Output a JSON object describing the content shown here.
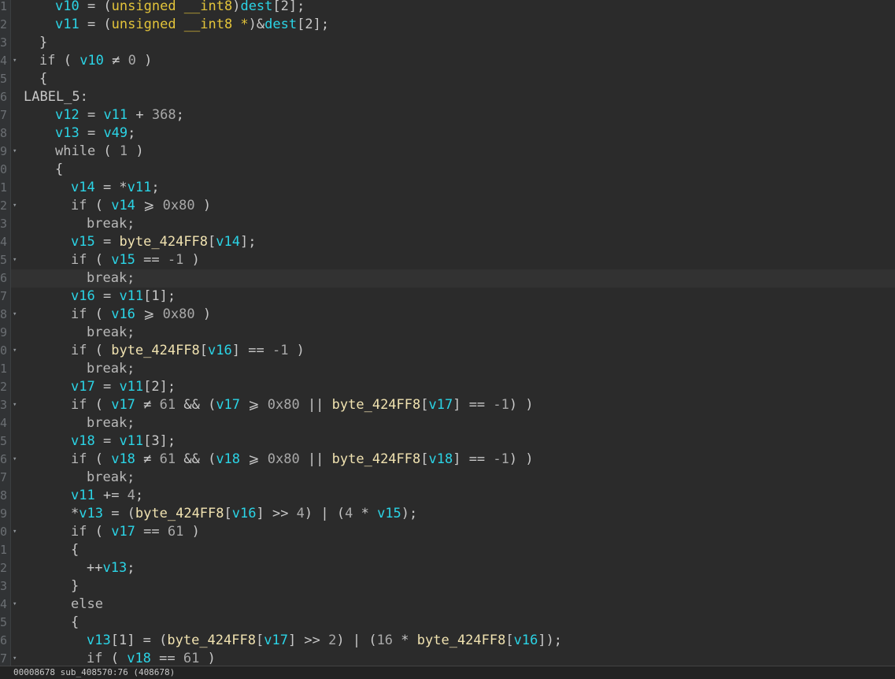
{
  "status_bar": {
    "text": "00008678 sub_408570:76 (408678)"
  },
  "gutter_numbers": [
    "1",
    "2",
    "3",
    "4",
    "5",
    "6",
    "7",
    "8",
    "9",
    "0",
    "1",
    "2",
    "3",
    "4",
    "5",
    "6",
    "7",
    "8",
    "9",
    "0",
    "1",
    "2",
    "3",
    "4",
    "5",
    "6",
    "7",
    "8",
    "9",
    "0",
    "1",
    "2",
    "3",
    "4",
    "5",
    "6",
    "7"
  ],
  "highlighted_line_index": 15,
  "code_lines": [
    {
      "indent": 2,
      "fold": false,
      "tokens": [
        [
          "v10",
          "var"
        ],
        [
          " = (",
          "op"
        ],
        [
          "unsigned __int8",
          "type"
        ],
        [
          ")",
          "op"
        ],
        [
          "dest",
          "var"
        ],
        [
          "[2];",
          "op"
        ]
      ]
    },
    {
      "indent": 2,
      "fold": false,
      "tokens": [
        [
          "v11",
          "var"
        ],
        [
          " = (",
          "op"
        ],
        [
          "unsigned __int8 *",
          "type"
        ],
        [
          ")&",
          "op"
        ],
        [
          "dest",
          "var"
        ],
        [
          "[2];",
          "op"
        ]
      ]
    },
    {
      "indent": 1,
      "fold": false,
      "tokens": [
        [
          "}",
          "op"
        ]
      ]
    },
    {
      "indent": 1,
      "fold": true,
      "tokens": [
        [
          "if",
          "kw"
        ],
        [
          " ( ",
          "op"
        ],
        [
          "v10",
          "var"
        ],
        [
          " ≠ ",
          "op"
        ],
        [
          "0",
          "num"
        ],
        [
          " )",
          "op"
        ]
      ]
    },
    {
      "indent": 1,
      "fold": false,
      "tokens": [
        [
          "{",
          "op"
        ]
      ]
    },
    {
      "indent": 0,
      "fold": false,
      "tokens": [
        [
          "LABEL_5:",
          "txt"
        ]
      ]
    },
    {
      "indent": 2,
      "fold": false,
      "tokens": [
        [
          "v12",
          "var"
        ],
        [
          " = ",
          "op"
        ],
        [
          "v11",
          "var"
        ],
        [
          " + ",
          "op"
        ],
        [
          "368",
          "num"
        ],
        [
          ";",
          "op"
        ]
      ]
    },
    {
      "indent": 2,
      "fold": false,
      "tokens": [
        [
          "v13",
          "var"
        ],
        [
          " = ",
          "op"
        ],
        [
          "v49",
          "var"
        ],
        [
          ";",
          "op"
        ]
      ]
    },
    {
      "indent": 2,
      "fold": true,
      "tokens": [
        [
          "while",
          "kw"
        ],
        [
          " ( ",
          "op"
        ],
        [
          "1",
          "num"
        ],
        [
          " )",
          "op"
        ]
      ]
    },
    {
      "indent": 2,
      "fold": false,
      "tokens": [
        [
          "{",
          "op"
        ]
      ]
    },
    {
      "indent": 3,
      "fold": false,
      "tokens": [
        [
          "v14",
          "var"
        ],
        [
          " = *",
          "op"
        ],
        [
          "v11",
          "var"
        ],
        [
          ";",
          "op"
        ]
      ]
    },
    {
      "indent": 3,
      "fold": true,
      "tokens": [
        [
          "if",
          "kw"
        ],
        [
          " ( ",
          "op"
        ],
        [
          "v14",
          "var"
        ],
        [
          " ⩾ ",
          "op"
        ],
        [
          "0x80",
          "num"
        ],
        [
          " )",
          "op"
        ]
      ]
    },
    {
      "indent": 4,
      "fold": false,
      "tokens": [
        [
          "break;",
          "kw"
        ]
      ]
    },
    {
      "indent": 3,
      "fold": false,
      "tokens": [
        [
          "v15",
          "var"
        ],
        [
          " = ",
          "op"
        ],
        [
          "byte_424FF8",
          "fn"
        ],
        [
          "[",
          "op"
        ],
        [
          "v14",
          "var"
        ],
        [
          "];",
          "op"
        ]
      ]
    },
    {
      "indent": 3,
      "fold": true,
      "tokens": [
        [
          "if",
          "kw"
        ],
        [
          " ( ",
          "op"
        ],
        [
          "v15",
          "var"
        ],
        [
          " == ",
          "op"
        ],
        [
          "-1",
          "num"
        ],
        [
          " )",
          "op"
        ]
      ]
    },
    {
      "indent": 4,
      "fold": false,
      "tokens": [
        [
          "break;",
          "kw"
        ]
      ]
    },
    {
      "indent": 3,
      "fold": false,
      "tokens": [
        [
          "v16",
          "var"
        ],
        [
          " = ",
          "op"
        ],
        [
          "v11",
          "var"
        ],
        [
          "[1];",
          "op"
        ]
      ]
    },
    {
      "indent": 3,
      "fold": true,
      "tokens": [
        [
          "if",
          "kw"
        ],
        [
          " ( ",
          "op"
        ],
        [
          "v16",
          "var"
        ],
        [
          " ⩾ ",
          "op"
        ],
        [
          "0x80",
          "num"
        ],
        [
          " )",
          "op"
        ]
      ]
    },
    {
      "indent": 4,
      "fold": false,
      "tokens": [
        [
          "break;",
          "kw"
        ]
      ]
    },
    {
      "indent": 3,
      "fold": true,
      "tokens": [
        [
          "if",
          "kw"
        ],
        [
          " ( ",
          "op"
        ],
        [
          "byte_424FF8",
          "fn"
        ],
        [
          "[",
          "op"
        ],
        [
          "v16",
          "var"
        ],
        [
          "] == ",
          "op"
        ],
        [
          "-1",
          "num"
        ],
        [
          " )",
          "op"
        ]
      ]
    },
    {
      "indent": 4,
      "fold": false,
      "tokens": [
        [
          "break;",
          "kw"
        ]
      ]
    },
    {
      "indent": 3,
      "fold": false,
      "tokens": [
        [
          "v17",
          "var"
        ],
        [
          " = ",
          "op"
        ],
        [
          "v11",
          "var"
        ],
        [
          "[2];",
          "op"
        ]
      ]
    },
    {
      "indent": 3,
      "fold": true,
      "tokens": [
        [
          "if",
          "kw"
        ],
        [
          " ( ",
          "op"
        ],
        [
          "v17",
          "var"
        ],
        [
          " ≠ ",
          "op"
        ],
        [
          "61",
          "num"
        ],
        [
          " && (",
          "op"
        ],
        [
          "v17",
          "var"
        ],
        [
          " ⩾ ",
          "op"
        ],
        [
          "0x80",
          "num"
        ],
        [
          " || ",
          "op"
        ],
        [
          "byte_424FF8",
          "fn"
        ],
        [
          "[",
          "op"
        ],
        [
          "v17",
          "var"
        ],
        [
          "] == ",
          "op"
        ],
        [
          "-1",
          "num"
        ],
        [
          ") )",
          "op"
        ]
      ]
    },
    {
      "indent": 4,
      "fold": false,
      "tokens": [
        [
          "break;",
          "kw"
        ]
      ]
    },
    {
      "indent": 3,
      "fold": false,
      "tokens": [
        [
          "v18",
          "var"
        ],
        [
          " = ",
          "op"
        ],
        [
          "v11",
          "var"
        ],
        [
          "[3];",
          "op"
        ]
      ]
    },
    {
      "indent": 3,
      "fold": true,
      "tokens": [
        [
          "if",
          "kw"
        ],
        [
          " ( ",
          "op"
        ],
        [
          "v18",
          "var"
        ],
        [
          " ≠ ",
          "op"
        ],
        [
          "61",
          "num"
        ],
        [
          " && (",
          "op"
        ],
        [
          "v18",
          "var"
        ],
        [
          " ⩾ ",
          "op"
        ],
        [
          "0x80",
          "num"
        ],
        [
          " || ",
          "op"
        ],
        [
          "byte_424FF8",
          "fn"
        ],
        [
          "[",
          "op"
        ],
        [
          "v18",
          "var"
        ],
        [
          "] == ",
          "op"
        ],
        [
          "-1",
          "num"
        ],
        [
          ") )",
          "op"
        ]
      ]
    },
    {
      "indent": 4,
      "fold": false,
      "tokens": [
        [
          "break;",
          "kw"
        ]
      ]
    },
    {
      "indent": 3,
      "fold": false,
      "tokens": [
        [
          "v11",
          "var"
        ],
        [
          " += ",
          "op"
        ],
        [
          "4",
          "num"
        ],
        [
          ";",
          "op"
        ]
      ]
    },
    {
      "indent": 3,
      "fold": false,
      "tokens": [
        [
          "*",
          "op"
        ],
        [
          "v13",
          "var"
        ],
        [
          " = (",
          "op"
        ],
        [
          "byte_424FF8",
          "fn"
        ],
        [
          "[",
          "op"
        ],
        [
          "v16",
          "var"
        ],
        [
          "] >> ",
          "op"
        ],
        [
          "4",
          "num"
        ],
        [
          ") | (",
          "op"
        ],
        [
          "4",
          "num"
        ],
        [
          " * ",
          "op"
        ],
        [
          "v15",
          "var"
        ],
        [
          ");",
          "op"
        ]
      ]
    },
    {
      "indent": 3,
      "fold": true,
      "tokens": [
        [
          "if",
          "kw"
        ],
        [
          " ( ",
          "op"
        ],
        [
          "v17",
          "var"
        ],
        [
          " == ",
          "op"
        ],
        [
          "61",
          "num"
        ],
        [
          " )",
          "op"
        ]
      ]
    },
    {
      "indent": 3,
      "fold": false,
      "tokens": [
        [
          "{",
          "op"
        ]
      ]
    },
    {
      "indent": 4,
      "fold": false,
      "tokens": [
        [
          "++",
          "op"
        ],
        [
          "v13",
          "var"
        ],
        [
          ";",
          "op"
        ]
      ]
    },
    {
      "indent": 3,
      "fold": false,
      "tokens": [
        [
          "}",
          "op"
        ]
      ]
    },
    {
      "indent": 3,
      "fold": true,
      "tokens": [
        [
          "else",
          "kw"
        ]
      ]
    },
    {
      "indent": 3,
      "fold": false,
      "tokens": [
        [
          "{",
          "op"
        ]
      ]
    },
    {
      "indent": 4,
      "fold": false,
      "tokens": [
        [
          "v13",
          "var"
        ],
        [
          "[1] = (",
          "op"
        ],
        [
          "byte_424FF8",
          "fn"
        ],
        [
          "[",
          "op"
        ],
        [
          "v17",
          "var"
        ],
        [
          "] >> ",
          "op"
        ],
        [
          "2",
          "num"
        ],
        [
          ") | (",
          "op"
        ],
        [
          "16",
          "num"
        ],
        [
          " * ",
          "op"
        ],
        [
          "byte_424FF8",
          "fn"
        ],
        [
          "[",
          "op"
        ],
        [
          "v16",
          "var"
        ],
        [
          "]);",
          "op"
        ]
      ]
    },
    {
      "indent": 4,
      "fold": true,
      "tokens": [
        [
          "if",
          "kw"
        ],
        [
          " ( ",
          "op"
        ],
        [
          "v18",
          "var"
        ],
        [
          " == ",
          "op"
        ],
        [
          "61",
          "num"
        ],
        [
          " )",
          "op"
        ]
      ]
    }
  ]
}
